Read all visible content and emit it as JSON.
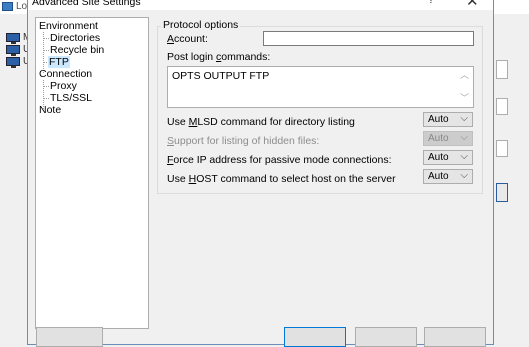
{
  "background": {
    "title_partial": "Lo",
    "tree_letters": [
      "M",
      "U",
      "U"
    ]
  },
  "dialog": {
    "title": "Advanced Site Settings",
    "help_glyph": "?",
    "close_glyph": "✕",
    "tree": {
      "items": [
        {
          "label": "Environment"
        },
        {
          "label": "Directories"
        },
        {
          "label": "Recycle bin"
        },
        {
          "label": "FTP",
          "selected": true
        },
        {
          "label": "Connection"
        },
        {
          "label": "Proxy"
        },
        {
          "label": "TLS/SSL"
        },
        {
          "label": "Note"
        }
      ]
    },
    "protocol_options": {
      "group_title": "Protocol options",
      "account": {
        "label_key": "A",
        "label_rest": "ccount:",
        "value": ""
      },
      "post_login": {
        "label_pre": "Post login ",
        "label_key": "c",
        "label_rest": "ommands:",
        "value": "OPTS OUTPUT FTP"
      },
      "settings": [
        {
          "pre": "Use ",
          "key": "M",
          "post": "LSD command for directory listing",
          "value": "Auto",
          "enabled": true
        },
        {
          "pre": "",
          "key": "S",
          "post": "upport for listing of hidden files:",
          "value": "Auto",
          "enabled": false
        },
        {
          "pre": "",
          "key": "F",
          "post": "orce IP address for passive mode connections:",
          "value": "Auto",
          "enabled": true
        },
        {
          "pre": "Use ",
          "key": "H",
          "post": "OST command to select host on the server",
          "value": "Auto",
          "enabled": true
        }
      ]
    }
  }
}
